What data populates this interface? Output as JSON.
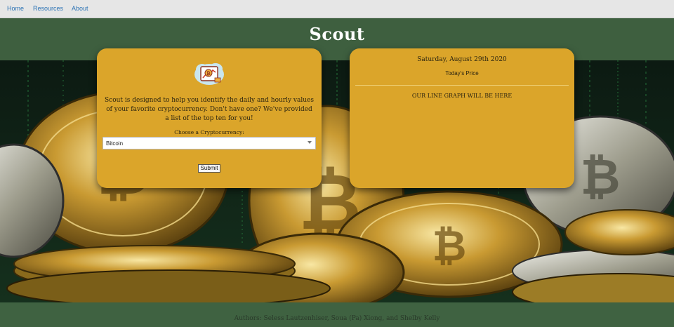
{
  "nav": {
    "items": [
      {
        "label": "Home"
      },
      {
        "label": "Resources"
      },
      {
        "label": "About"
      }
    ]
  },
  "header": {
    "title": "Scout"
  },
  "intro_card": {
    "logo_icon": "crypto-chart-icon",
    "description": "Scout is designed to help you identify the daily and hourly values of your favorite cryptocurrency. Don't have one? We've provided a list of the top ten for you!",
    "select_label": "Choose a Cryptocurrency:",
    "select_value": "Bitcoin",
    "submit_label": "Submit"
  },
  "price_card": {
    "date": "Saturday, August 29th 2020",
    "price_label": "Today's Price",
    "graph_placeholder": "OUR LINE GRAPH WILL BE HERE"
  },
  "footer": {
    "authors": "Authors: Seless Lautzenhiser, Soua (Pa) Xiong, and Shelby Kelly"
  },
  "colors": {
    "card": "#dba52a",
    "band": "#3e5f3f",
    "nav_link": "#2e74b5"
  }
}
